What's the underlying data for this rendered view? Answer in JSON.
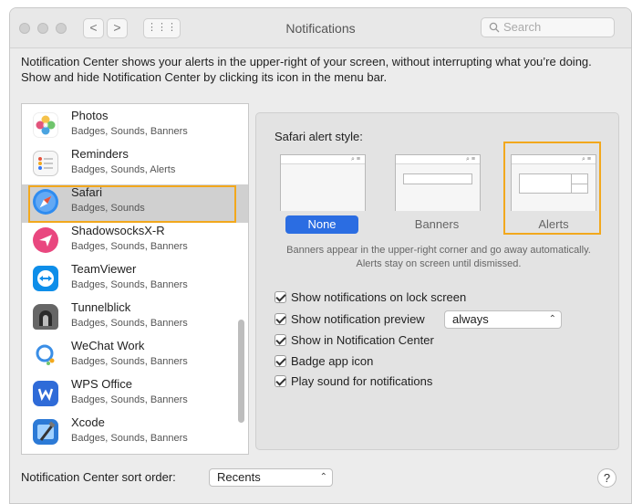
{
  "window": {
    "title": "Notifications"
  },
  "toolbar": {
    "back": "<",
    "forward": ">",
    "grid": "⋮⋮⋮",
    "search_placeholder": "Search"
  },
  "intro": "Notification Center shows your alerts in the upper-right of your screen, without interrupting what you’re doing. Show and hide Notification Center by clicking its icon in the menu bar.",
  "apps": [
    {
      "name": "Photos",
      "detail": "Badges, Sounds, Banners",
      "icon": "photos-icon"
    },
    {
      "name": "Reminders",
      "detail": "Badges, Sounds, Alerts",
      "icon": "reminders-icon"
    },
    {
      "name": "Safari",
      "detail": "Badges, Sounds",
      "icon": "safari-icon",
      "selected": true
    },
    {
      "name": "ShadowsocksX-R",
      "detail": "Badges, Sounds, Banners",
      "icon": "shadowsocks-icon"
    },
    {
      "name": "TeamViewer",
      "detail": "Badges, Sounds, Banners",
      "icon": "teamviewer-icon"
    },
    {
      "name": "Tunnelblick",
      "detail": "Badges, Sounds, Banners",
      "icon": "tunnelblick-icon"
    },
    {
      "name": "WeChat Work",
      "detail": "Badges, Sounds, Banners",
      "icon": "wechat-work-icon"
    },
    {
      "name": "WPS Office",
      "detail": "Badges, Sounds, Banners",
      "icon": "wps-office-icon"
    },
    {
      "name": "Xcode",
      "detail": "Badges, Sounds, Banners",
      "icon": "xcode-icon"
    }
  ],
  "panel": {
    "alert_style_label": "Safari alert style:",
    "styles": [
      "None",
      "Banners",
      "Alerts"
    ],
    "selected_style": "None",
    "description": "Banners appear in the upper-right corner and go away automatically. Alerts stay on screen until dismissed.",
    "options": [
      {
        "label": "Show notifications on lock screen",
        "checked": true
      },
      {
        "label": "Show notification preview",
        "checked": true
      },
      {
        "label": "Show in Notification Center",
        "checked": true
      },
      {
        "label": "Badge app icon",
        "checked": true
      },
      {
        "label": "Play sound for notifications",
        "checked": true
      }
    ],
    "preview_value": "always"
  },
  "footer": {
    "sort_label": "Notification Center sort order:",
    "sort_value": "Recents",
    "help": "?"
  },
  "colors": {
    "accent": "#2b6de2",
    "highlight": "#f2a81d"
  }
}
